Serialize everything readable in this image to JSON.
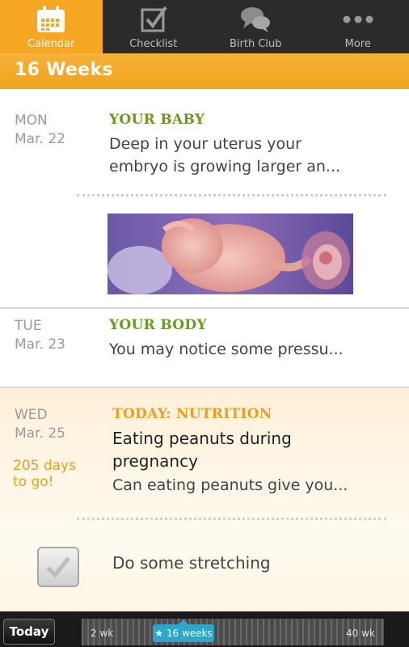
{
  "tabs": [
    {
      "label": "Calendar",
      "icon": "calendar-icon",
      "active": true
    },
    {
      "label": "Checklist",
      "icon": "checklist-icon",
      "active": false
    },
    {
      "label": "Birth Club",
      "icon": "chat-bubbles-icon",
      "active": false
    },
    {
      "label": "More",
      "icon": "more-dots-icon",
      "active": false
    }
  ],
  "week_header": "16 Weeks",
  "entries": [
    {
      "day": "MON",
      "date": "Mar. 22",
      "category": "YOUR BABY",
      "text": "Deep in your uterus your embryo is growing larger an..."
    },
    {
      "day": "TUE",
      "date": "Mar. 23",
      "category": "YOUR BODY",
      "text": "You may notice some pressu..."
    },
    {
      "day": "WED",
      "date": "Mar. 25",
      "days_left": "205 days to go!",
      "category": "TODAY: NUTRITION",
      "headline": "Eating peanuts during pregnancy",
      "text": "Can eating peanuts give you..."
    }
  ],
  "task": {
    "label": "Do some stretching",
    "checked": true
  },
  "bottom": {
    "today_button": "Today",
    "timeline_start": "2 wk",
    "timeline_current": "★ 16 weeks",
    "timeline_end": "40 wk"
  },
  "colors": {
    "accent": "#f5a623",
    "baby_green": "#6a9a1f",
    "today_orange": "#e8a020",
    "timeline_marker": "#2aa7c9"
  }
}
